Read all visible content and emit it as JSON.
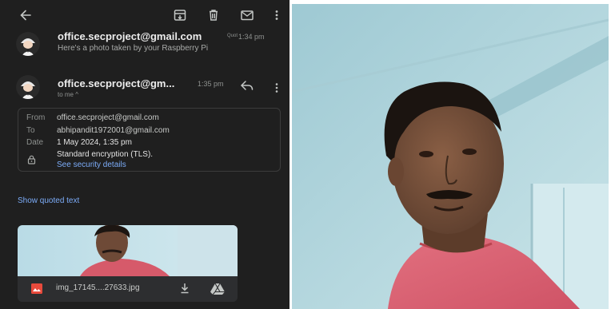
{
  "toolbar": {
    "icons": [
      "arrow-back-icon",
      "archive-icon",
      "trash-icon",
      "mail-icon",
      "more-vert-icon"
    ]
  },
  "messages": [
    {
      "sender": "office.secproject@gmail.com",
      "tag": "Quot",
      "time": "1:34 pm",
      "snippet": "Here's a photo taken by your Raspberry Pi"
    },
    {
      "sender": "office.secproject@gm...",
      "time": "1:35 pm",
      "recipient_line": "to me ^"
    }
  ],
  "details": {
    "from_label": "From",
    "from_value": "office.secproject@gmail.com",
    "to_label": "To",
    "to_value": "abhipandit1972001@gmail.com",
    "date_label": "Date",
    "date_value": "1 May 2024, 1:35 pm",
    "encryption": "Standard encryption (TLS).",
    "security_link": "See security details"
  },
  "show_quoted": "Show quoted text",
  "attachment": {
    "filename": "img_17145....27633.jpg"
  },
  "colors": {
    "panel_bg": "#1f1f1f",
    "link": "#7cacf8",
    "image_icon": "#e84a3c"
  }
}
